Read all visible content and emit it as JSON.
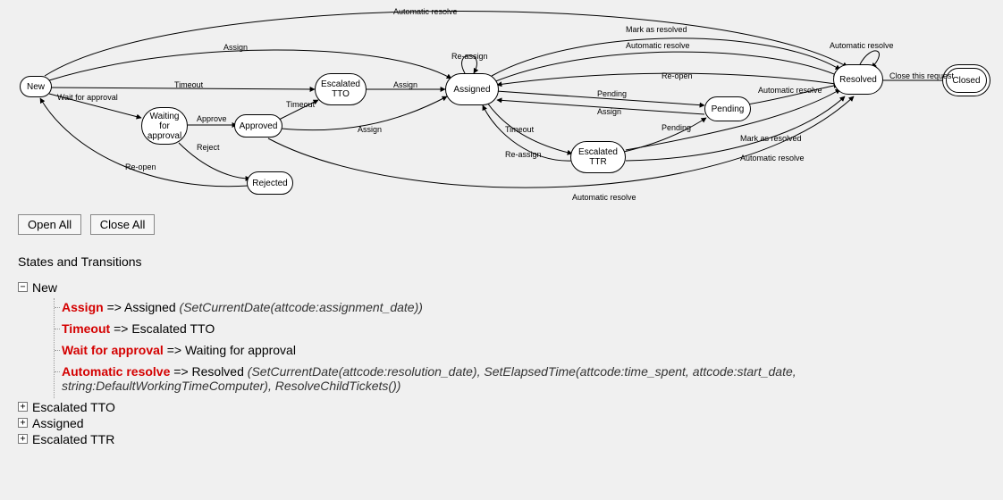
{
  "buttons": {
    "open_all": "Open All",
    "close_all": "Close All"
  },
  "section_title": "States and Transitions",
  "toggle": {
    "plus": "+",
    "minus": "−"
  },
  "states": {
    "new": "New",
    "waiting": "Waiting\nfor\napproval",
    "approved": "Approved",
    "rejected": "Rejected",
    "etto": "Escalated\nTTO",
    "assigned": "Assigned",
    "ettr": "Escalated\nTTR",
    "pending": "Pending",
    "resolved": "Resolved",
    "closed": "Closed"
  },
  "edge_labels": {
    "auto_top": "Automatic resolve",
    "assign_top": "Assign",
    "timeout1": "Timeout",
    "wait": "Wait for approval",
    "approve": "Approve",
    "reject": "Reject",
    "reopen_rej": "Re-open",
    "timeout2": "Timeout",
    "assign_apr": "Assign",
    "assign_etto": "Assign",
    "reassign1": "Re-assign",
    "mark1": "Mark as resolved",
    "auto2": "Automatic resolve",
    "reopen2": "Re-open",
    "auto3": "Automatic resolve",
    "pending1": "Pending",
    "assign2": "Assign",
    "timeout3": "Timeout",
    "reassign2": "Re-assign",
    "pending2": "Pending",
    "mark2": "Mark as resolved",
    "auto4": "Automatic resolve",
    "auto_bottom": "Automatic resolve",
    "auto_loop": "Automatic resolve",
    "close": "Close this request"
  },
  "tree": {
    "new": {
      "label": "New",
      "open": true,
      "items": [
        {
          "name": "Assign",
          "target": "Assigned",
          "actions": "(SetCurrentDate(attcode:assignment_date))"
        },
        {
          "name": "Timeout",
          "target": "Escalated TTO",
          "actions": ""
        },
        {
          "name": "Wait for approval",
          "target": "Waiting for approval",
          "actions": ""
        },
        {
          "name": "Automatic resolve",
          "target": "Resolved",
          "actions": "(SetCurrentDate(attcode:resolution_date), SetElapsedTime(attcode:time_spent, attcode:start_date, string:DefaultWorkingTimeComputer), ResolveChildTickets())"
        }
      ]
    },
    "etto": {
      "label": "Escalated TTO",
      "open": false
    },
    "assigned": {
      "label": "Assigned",
      "open": false
    },
    "ettr": {
      "label": "Escalated TTR",
      "open": false
    }
  }
}
